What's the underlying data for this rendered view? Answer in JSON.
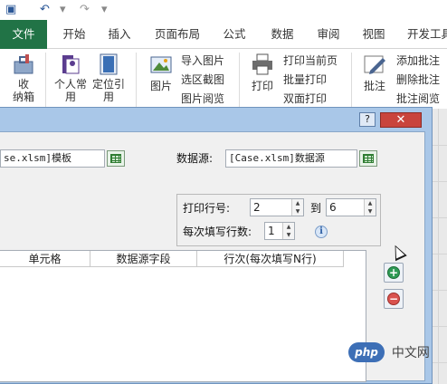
{
  "quick_access": {
    "save_icon": "save-icon",
    "undo_icon": "undo-icon",
    "redo_icon": "redo-icon"
  },
  "tabs": [
    "文件",
    "开始",
    "插入",
    "页面布局",
    "公式",
    "数据",
    "审阅",
    "视图",
    "开发工具"
  ],
  "ribbon": {
    "collapse_label": "收\n纳箱",
    "personal_label": "个人常\n用",
    "locate_label": "定位引\n用",
    "image_label": "图片",
    "image_items": [
      "导入图片",
      "选区截图",
      "图片阅览"
    ],
    "print_label": "打印",
    "print_items": [
      "打印当前页",
      "批量打印",
      "双面打印"
    ],
    "comment_label": "批注",
    "comment_items": [
      "添加批注",
      "删除批注",
      "批注阅览"
    ]
  },
  "dialog": {
    "help_label": "?",
    "close_label": "✕",
    "template_value": "se.xlsm]模板",
    "datasource_label": "数据源:",
    "datasource_value": "[Case.xlsm]数据源",
    "print_row_label": "打印行号:",
    "row_from": "2",
    "to_label": "到",
    "row_to": "6",
    "per_fill_label": "每次填写行数:",
    "per_fill_value": "1",
    "columns": [
      "单元格",
      "数据源字段",
      "行次(每次填写N行)"
    ],
    "add_label": "+",
    "remove_label": "−"
  },
  "watermark": {
    "logo": "php",
    "text": "中文网"
  },
  "colors": {
    "file_tab": "#217346",
    "dialog_frame": "#a9c7e8",
    "close_button": "#c9443c"
  }
}
